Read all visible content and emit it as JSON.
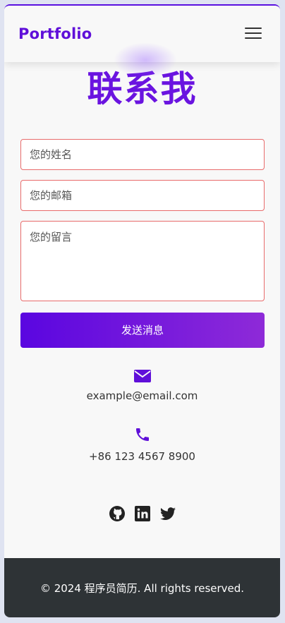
{
  "nav": {
    "logo": "Portfolio",
    "menu_icon": "hamburger-menu-icon"
  },
  "contact": {
    "title": "联系我",
    "name_placeholder": "您的姓名",
    "email_placeholder": "您的邮箱",
    "message_placeholder": "您的留言",
    "send_label": "发送消息"
  },
  "info": {
    "email_icon": "envelope-icon",
    "email": "example@email.com",
    "phone_icon": "phone-icon",
    "phone": "+86 123 4567 8900"
  },
  "social": {
    "icons": [
      "github-icon",
      "linkedin-icon",
      "twitter-icon"
    ]
  },
  "footer": {
    "text": "© 2024 程序员简历. All rights reserved."
  },
  "colors": {
    "accent": "#5f0fd9",
    "accent_end": "#8e2ad8",
    "footer_bg": "#2e3336",
    "field_border": "#e86b6b"
  }
}
